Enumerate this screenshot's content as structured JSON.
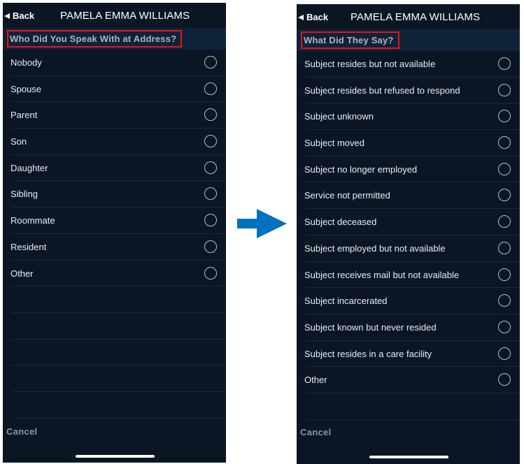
{
  "arrow": {
    "color": "#0070c0",
    "icon": "right-arrow-icon"
  },
  "screens": [
    {
      "nav": {
        "back_label": "Back",
        "title": "PAMELA EMMA WILLIAMS"
      },
      "section_title": "Who Did You Speak With at Address?",
      "options": [
        "Nobody",
        "Spouse",
        "Parent",
        "Son",
        "Daughter",
        "Sibling",
        "Roommate",
        "Resident",
        "Other"
      ],
      "cancel_label": "Cancel"
    },
    {
      "nav": {
        "back_label": "Back",
        "title": "PAMELA EMMA WILLIAMS"
      },
      "section_title": "What Did They Say?",
      "options": [
        "Subject resides but not available",
        "Subject resides but refused to respond",
        "Subject unknown",
        "Subject moved",
        "Subject no longer employed",
        "Service not permitted",
        "Subject deceased",
        "Subject employed but not available",
        "Subject receives mail but not available",
        "Subject incarcerated",
        "Subject known but never resided",
        "Subject resides in a care facility",
        "Other"
      ],
      "cancel_label": "Cancel"
    }
  ]
}
